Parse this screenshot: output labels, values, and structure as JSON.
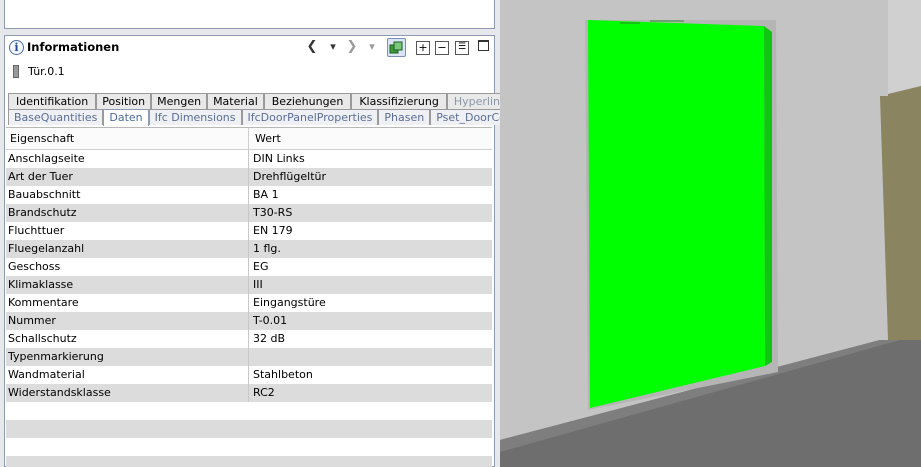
{
  "panel": {
    "title": "Informationen",
    "object_name": "Tür.0.1",
    "toolbar": {
      "back": "❮",
      "dropdown": "▾",
      "forward": "❯",
      "forward_dropdown": "▾",
      "expand_all": "+",
      "collapse_all": "−",
      "list": "☰"
    }
  },
  "tabs_row1": [
    "Identifikation",
    "Position",
    "Mengen",
    "Material",
    "Beziehungen",
    "Klassifizierung",
    "Hyperlinks"
  ],
  "tabs_row2": [
    "BaseQuantities",
    "Daten",
    "Ifc Dimensions",
    "IfcDoorPanelProperties",
    "Phasen",
    "Pset_DoorCommon"
  ],
  "grid": {
    "col_property": "Eigenschaft",
    "col_value": "Wert",
    "rows": [
      [
        "Anschlagseite",
        "DIN Links"
      ],
      [
        "Art der Tuer",
        "Drehflügeltür"
      ],
      [
        "Bauabschnitt",
        "BA 1"
      ],
      [
        "Brandschutz",
        "T30-RS"
      ],
      [
        "Fluchttuer",
        "EN 179"
      ],
      [
        "Fluegelanzahl",
        "1 flg."
      ],
      [
        "Geschoss",
        "EG"
      ],
      [
        "Klimaklasse",
        "III"
      ],
      [
        "Kommentare",
        "Eingangstüre"
      ],
      [
        "Nummer",
        "T-0.01"
      ],
      [
        "Schallschutz",
        "32 dB"
      ],
      [
        "Typenmarkierung",
        ""
      ],
      [
        "Wandmaterial",
        "Stahlbeton"
      ],
      [
        "Widerstandsklasse",
        "RC2"
      ]
    ]
  },
  "colors": {
    "door_highlight": "#00ff00",
    "wall": "#c4c4c4",
    "floor": "#6e6e6e"
  }
}
